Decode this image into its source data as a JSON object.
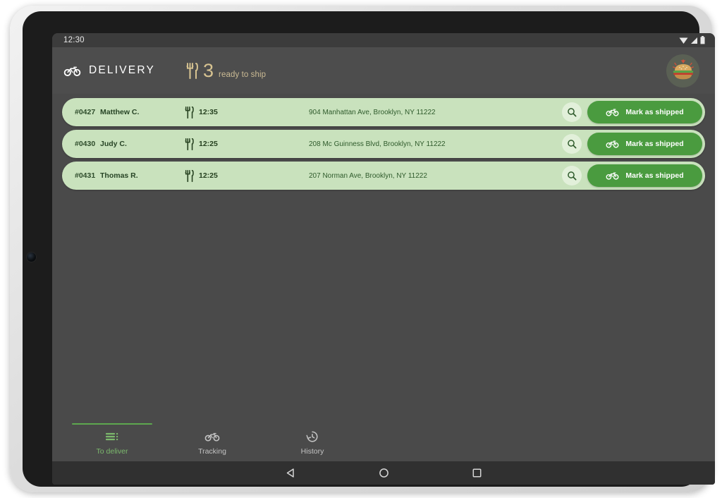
{
  "status_bar": {
    "time": "12:30",
    "icons": [
      "wifi-icon",
      "signal-icon",
      "battery-icon"
    ]
  },
  "header": {
    "brand_icon": "bicycle-icon",
    "brand_title": "DELIVERY",
    "ready_icon": "cutlery-icon",
    "ready_count": "3",
    "ready_label": "ready to ship",
    "avatar_icon": "burger-avatar-icon"
  },
  "orders": {
    "columns": [
      "id",
      "customer",
      "time",
      "address"
    ],
    "search_icon": "search-icon",
    "ship_icon": "bicycle-icon",
    "ship_label": "Mark as shipped",
    "time_icon": "cutlery-icon",
    "rows": [
      {
        "id": "#0427",
        "customer": "Matthew C.",
        "time": "12:35",
        "address": "904 Manhattan Ave, Brooklyn, NY 11222"
      },
      {
        "id": "#0430",
        "customer": "Judy C.",
        "time": "12:25",
        "address": "208 Mc Guinness Blvd, Brooklyn, NY 11222"
      },
      {
        "id": "#0431",
        "customer": "Thomas R.",
        "time": "12:25",
        "address": "207 Norman Ave, Brooklyn, NY 11222"
      }
    ]
  },
  "bottom_nav": {
    "items": [
      {
        "label": "To deliver",
        "icon": "list-icon",
        "active": true
      },
      {
        "label": "Tracking",
        "icon": "bicycle-icon",
        "active": false
      },
      {
        "label": "History",
        "icon": "clock-history-icon",
        "active": false
      }
    ]
  },
  "system_nav": {
    "back": "back-triangle-icon",
    "home": "home-circle-icon",
    "recents": "recents-square-icon"
  },
  "colors": {
    "accent_green": "#4a9b3f",
    "row_green": "#c9e2bd",
    "app_bg": "#4a4a4a",
    "header_bg": "#4d4d4d",
    "gold": "#d7c391",
    "nav_active": "#7cb96d"
  }
}
